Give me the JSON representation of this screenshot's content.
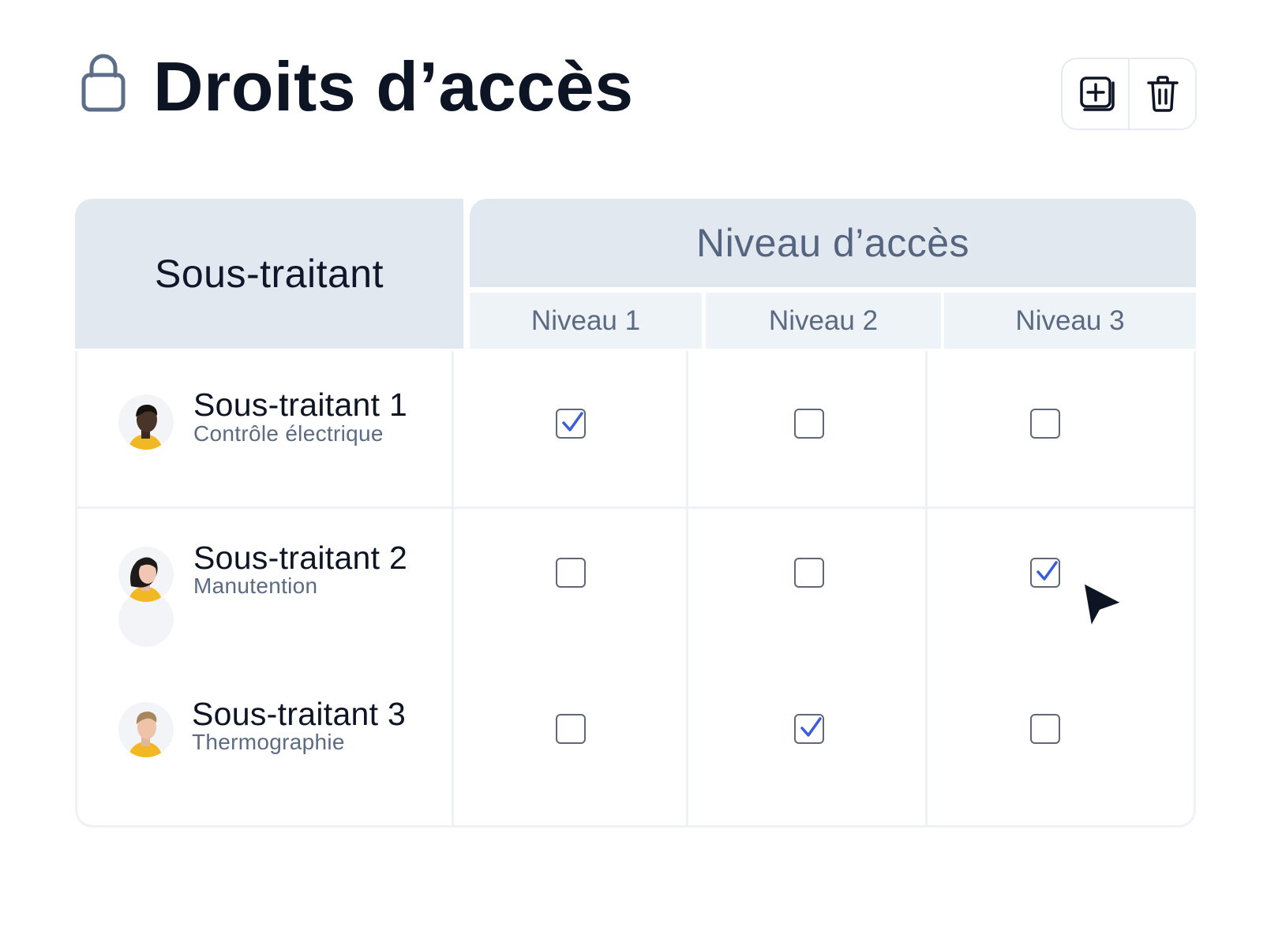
{
  "header": {
    "title": "Droits d’accès",
    "lock_icon": "lock-icon",
    "actions": [
      {
        "icon": "duplicate-add-icon"
      },
      {
        "icon": "trash-icon"
      }
    ]
  },
  "table": {
    "col_subcontractor": "Sous-traitant",
    "col_access_level": "Niveau d’accès",
    "levels": [
      "Niveau 1",
      "Niveau 2",
      "Niveau 3"
    ],
    "rows": [
      {
        "name": "Sous-traitant 1",
        "role": "Contrôle électrique",
        "checked": [
          true,
          false,
          false
        ]
      },
      {
        "name": "Sous-traitant 2",
        "role": "Manutention",
        "checked": [
          false,
          false,
          true
        ]
      },
      {
        "name": "Sous-traitant 3",
        "role": "Thermographie",
        "checked": [
          false,
          true,
          false
        ]
      }
    ]
  },
  "colors": {
    "header_bg": "#e1e8f0",
    "subheader_bg": "#eef3f8",
    "check_accent": "#3b5bdb",
    "avatar_jacket": "#f2b824"
  }
}
